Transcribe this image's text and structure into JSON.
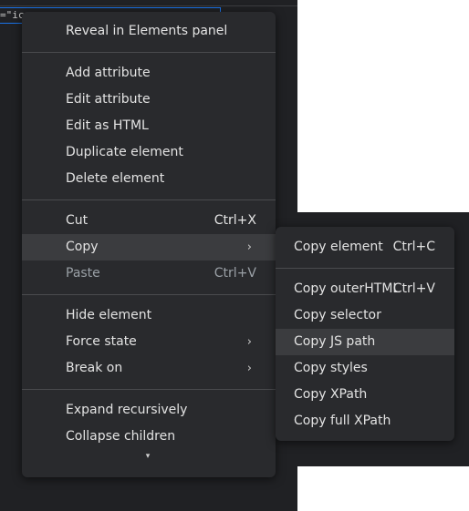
{
  "background": {
    "code_snippet": "=\"ico"
  },
  "main_menu": {
    "reveal": "Reveal in Elements panel",
    "add_attribute": "Add attribute",
    "edit_attribute": "Edit attribute",
    "edit_html": "Edit as HTML",
    "duplicate": "Duplicate element",
    "delete": "Delete element",
    "cut": "Cut",
    "cut_shortcut": "Ctrl+X",
    "copy": "Copy",
    "paste": "Paste",
    "paste_shortcut": "Ctrl+V",
    "hide": "Hide element",
    "force_state": "Force state",
    "break_on": "Break on",
    "expand": "Expand recursively",
    "collapse": "Collapse children",
    "submenu_arrow": "›",
    "more_arrow": "▾"
  },
  "copy_submenu": {
    "copy_element": "Copy element",
    "copy_element_shortcut": "Ctrl+C",
    "copy_outer_html": "Copy outerHTML",
    "copy_outer_html_shortcut": "Ctrl+V",
    "copy_selector": "Copy selector",
    "copy_js_path": "Copy JS path",
    "copy_styles": "Copy styles",
    "copy_xpath": "Copy XPath",
    "copy_full_xpath": "Copy full XPath"
  }
}
